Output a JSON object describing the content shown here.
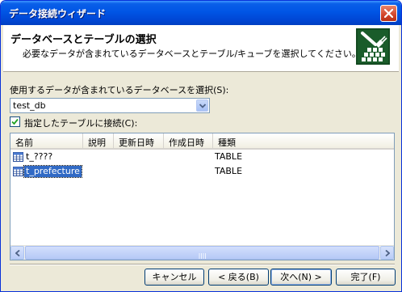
{
  "window": {
    "title": "データ接続ウィザード"
  },
  "header": {
    "title": "データベースとテーブルの選択",
    "subtitle": "必要なデータが含まれているデータベースとテーブル/キューブを選択してください。"
  },
  "database": {
    "label": "使用するデータが含まれているデータベースを選択(S):",
    "selected": "test_db"
  },
  "connect_table": {
    "label": "指定したテーブルに接続(C):",
    "checked": true
  },
  "table_list": {
    "columns": [
      "名前",
      "説明",
      "更新日時",
      "作成日時",
      "種類"
    ],
    "rows": [
      {
        "name": "t_????",
        "description": "",
        "modified": "",
        "created": "",
        "type": "TABLE",
        "selected": false
      },
      {
        "name": "t_prefecture",
        "description": "",
        "modified": "",
        "created": "",
        "type": "TABLE",
        "selected": true
      }
    ]
  },
  "buttons": {
    "cancel": "キャンセル",
    "back": "< 戻る(B)",
    "next": "次へ(N) >",
    "finish": "完了(F)"
  }
}
